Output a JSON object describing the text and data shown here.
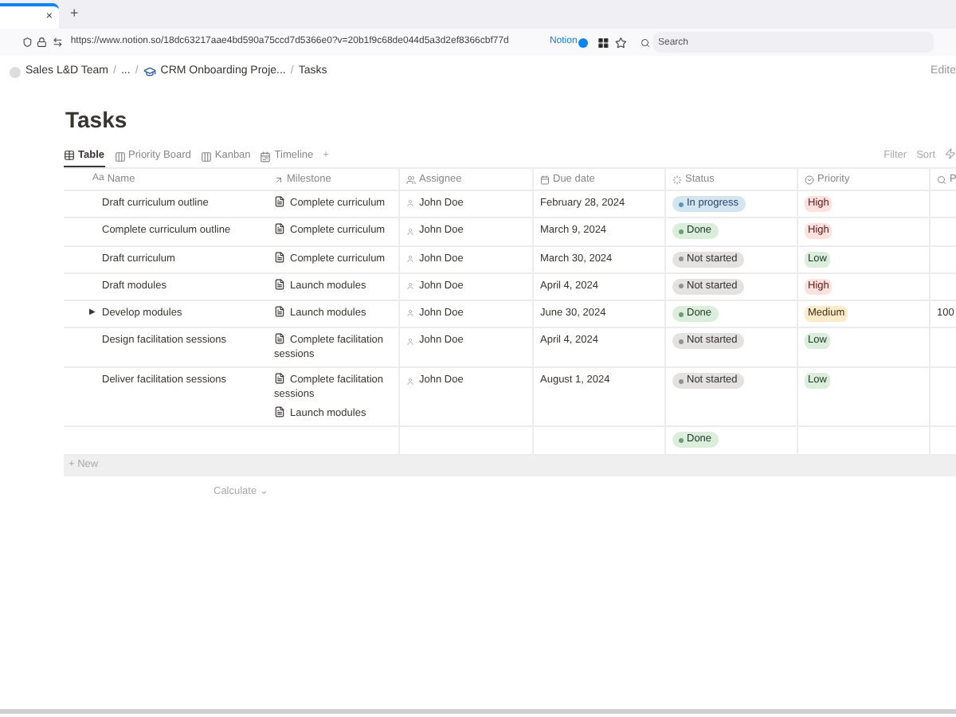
{
  "browser": {
    "tab_close": "×",
    "new_tab": "+",
    "url": "https://www.notion.so/18dc63217aae4bd590a75ccd7d5366e0?v=20b1f9c68de044d5a3d2ef8366cbf77d",
    "notion_badge": "Notion",
    "search": {
      "placeholder": "Search"
    }
  },
  "breadcrumb": [
    "Sales L&D Team",
    "...",
    "CRM Onboarding Proje...",
    "Tasks"
  ],
  "breadcrumb_separator": "/",
  "toggle": "▶",
  "edited": "Edite",
  "title": "Tasks",
  "views": [
    {
      "label": "Table",
      "selected": true,
      "kind": "table"
    },
    {
      "label": "Priority Board",
      "selected": false,
      "kind": "board"
    },
    {
      "label": "Kanban",
      "selected": false,
      "kind": "board"
    },
    {
      "label": "Timeline",
      "selected": false,
      "kind": "timeline"
    }
  ],
  "add_view": "+",
  "toolbar": [
    "Filter",
    "Sort"
  ],
  "columns": [
    {
      "label": "Name",
      "kind": "name",
      "type_mark": "Aa"
    },
    {
      "label": "Milestone",
      "kind": "relation"
    },
    {
      "label": "Assignee",
      "kind": "person"
    },
    {
      "label": "Due date",
      "kind": "date"
    },
    {
      "label": "Status",
      "kind": "status"
    },
    {
      "label": "Priority",
      "kind": "select"
    },
    {
      "label": "P",
      "kind": "search"
    }
  ],
  "rows": [
    {
      "name": "Draft curriculum outline",
      "expandable": false,
      "milestones": [
        "Complete curriculum"
      ],
      "assignee": "John Doe",
      "due": "February 28, 2024",
      "status": {
        "label": "In progress",
        "kind": "in_progress"
      },
      "priority": {
        "label": "High",
        "kind": "high"
      }
    },
    {
      "name": "Complete curriculum outline",
      "expandable": false,
      "milestones": [
        "Complete curriculum"
      ],
      "assignee": "John Doe",
      "due": "March 9, 2024",
      "status": {
        "label": "Done",
        "kind": "done"
      },
      "priority": {
        "label": "High",
        "kind": "high"
      }
    },
    {
      "name": "Draft curriculum",
      "expandable": false,
      "milestones": [
        "Complete curriculum"
      ],
      "assignee": "John Doe",
      "due": "March 30, 2024",
      "status": {
        "label": "Not started",
        "kind": "not_started"
      },
      "priority": {
        "label": "Low",
        "kind": "low"
      }
    },
    {
      "name": "Draft modules",
      "expandable": false,
      "milestones": [
        "Launch modules"
      ],
      "assignee": "John Doe",
      "due": "April 4, 2024",
      "status": {
        "label": "Not started",
        "kind": "not_started"
      },
      "priority": {
        "label": "High",
        "kind": "high"
      }
    },
    {
      "name": "Develop modules",
      "expandable": true,
      "milestones": [
        "Launch modules"
      ],
      "assignee": "John Doe",
      "due": "June 30, 2024",
      "status": {
        "label": "Done",
        "kind": "done"
      },
      "priority": {
        "label": "Medium",
        "kind": "medium"
      },
      "column_7": "100"
    },
    {
      "name": "Design facilitation sessions",
      "expandable": false,
      "milestones": [
        "Complete facilitation sessions"
      ],
      "assignee": "John Doe",
      "due": "April 4, 2024",
      "status": {
        "label": "Not started",
        "kind": "not_started"
      },
      "priority": {
        "label": "Low",
        "kind": "low"
      }
    },
    {
      "name": "Deliver facilitation sessions",
      "expandable": false,
      "milestones": [
        "Complete facilitation sessions",
        "Launch modules"
      ],
      "assignee": "John Doe",
      "due": "August 1, 2024",
      "status": {
        "label": "Not started",
        "kind": "not_started"
      },
      "priority": {
        "label": "Low",
        "kind": "low"
      }
    },
    {
      "status": {
        "label": "Done",
        "kind": "done"
      }
    }
  ],
  "new_row": "+ New",
  "calculate": "Calculate ⌄"
}
